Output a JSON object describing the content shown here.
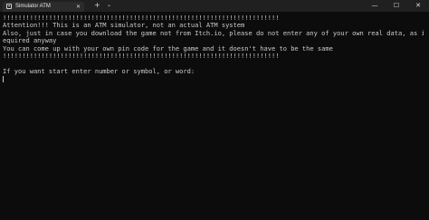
{
  "window": {
    "tab_title": "Simulator ATM",
    "tab_close_glyph": "✕",
    "new_tab_glyph": "+",
    "dropdown_glyph": "⌄",
    "minimize_glyph": "—",
    "maximize_glyph": "☐",
    "close_glyph": "✕"
  },
  "terminal": {
    "lines": [
      "!!!!!!!!!!!!!!!!!!!!!!!!!!!!!!!!!!!!!!!!!!!!!!!!!!!!!!!!!!!!!!!!!!!!!!!!",
      "Attention!!! This is an ATM simulator, not an actual ATM system",
      "Also, just in case you download the game not from Itch.io, please do not enter any of your own real data, as it is not r",
      "equired anyway",
      "You can come up with your own pin code for the game and it doesn't have to be the same",
      "!!!!!!!!!!!!!!!!!!!!!!!!!!!!!!!!!!!!!!!!!!!!!!!!!!!!!!!!!!!!!!!!!!!!!!!!",
      "",
      "If you want start enter number or symbol, or word:"
    ]
  },
  "colors": {
    "background": "#0c0c0c",
    "text": "#cccccc",
    "titlebar": "#202020",
    "active_tab": "#2b2b2b"
  }
}
